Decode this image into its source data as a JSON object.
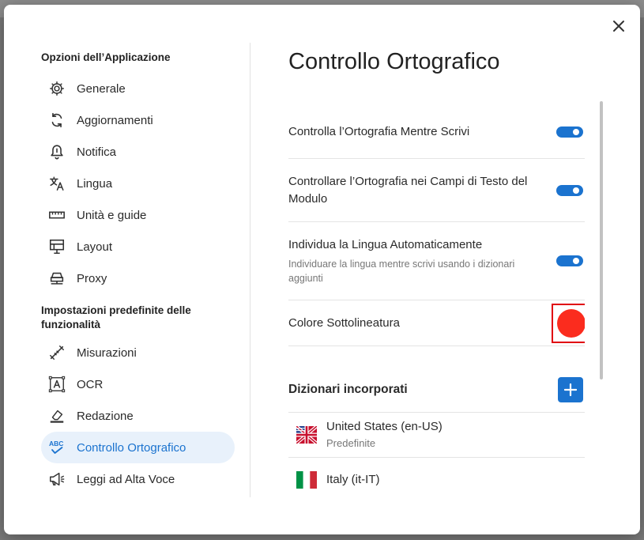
{
  "dialog": {
    "close_icon": "close-icon"
  },
  "sidebar": {
    "section1_title": "Opzioni dell’Applicazione",
    "section2_title": "Impostazioni predefinite delle funzionalità",
    "items": [
      {
        "label": "Generale",
        "icon": "gear-icon"
      },
      {
        "label": "Aggiornamenti",
        "icon": "sync-icon"
      },
      {
        "label": "Notifica",
        "icon": "bell-icon"
      },
      {
        "label": "Lingua",
        "icon": "translate-icon"
      },
      {
        "label": "Unità e guide",
        "icon": "ruler-icon"
      },
      {
        "label": "Layout",
        "icon": "layout-icon"
      },
      {
        "label": "Proxy",
        "icon": "proxy-icon"
      },
      {
        "label": "Misurazioni",
        "icon": "measure-icon"
      },
      {
        "label": "OCR",
        "icon": "ocr-icon"
      },
      {
        "label": "Redazione",
        "icon": "eraser-icon"
      },
      {
        "label": "Controllo Ortografico",
        "icon": "spellcheck-icon"
      },
      {
        "label": "Leggi ad Alta Voce",
        "icon": "megaphone-icon"
      }
    ],
    "active_item": "Controllo Ortografico"
  },
  "main": {
    "title": "Controllo Ortografico",
    "settings": [
      {
        "label": "Controlla l’Ortografia Mentre Scrivi",
        "enabled": true
      },
      {
        "label": "Controllare l’Ortografia nei Campi di Testo del Modulo",
        "enabled": true
      },
      {
        "label": "Individua la Lingua Automaticamente",
        "sub": "Individuare la lingua mentre scrivi usando i dizionari aggiunti",
        "enabled": true
      }
    ],
    "underline_color": {
      "label": "Colore Sottolineatura",
      "value": "#fb2c1e"
    },
    "dictionaries": {
      "title": "Dizionari incorporati",
      "add_icon": "plus-icon",
      "items": [
        {
          "name": "United States (en-US)",
          "sub": "Predefinite",
          "flag": "flag-uk-icon"
        },
        {
          "name": "Italy (it-IT)",
          "flag": "flag-italy-icon"
        }
      ]
    }
  },
  "colors": {
    "accent": "#1b73cf",
    "active_bg": "#e8f1fb"
  }
}
